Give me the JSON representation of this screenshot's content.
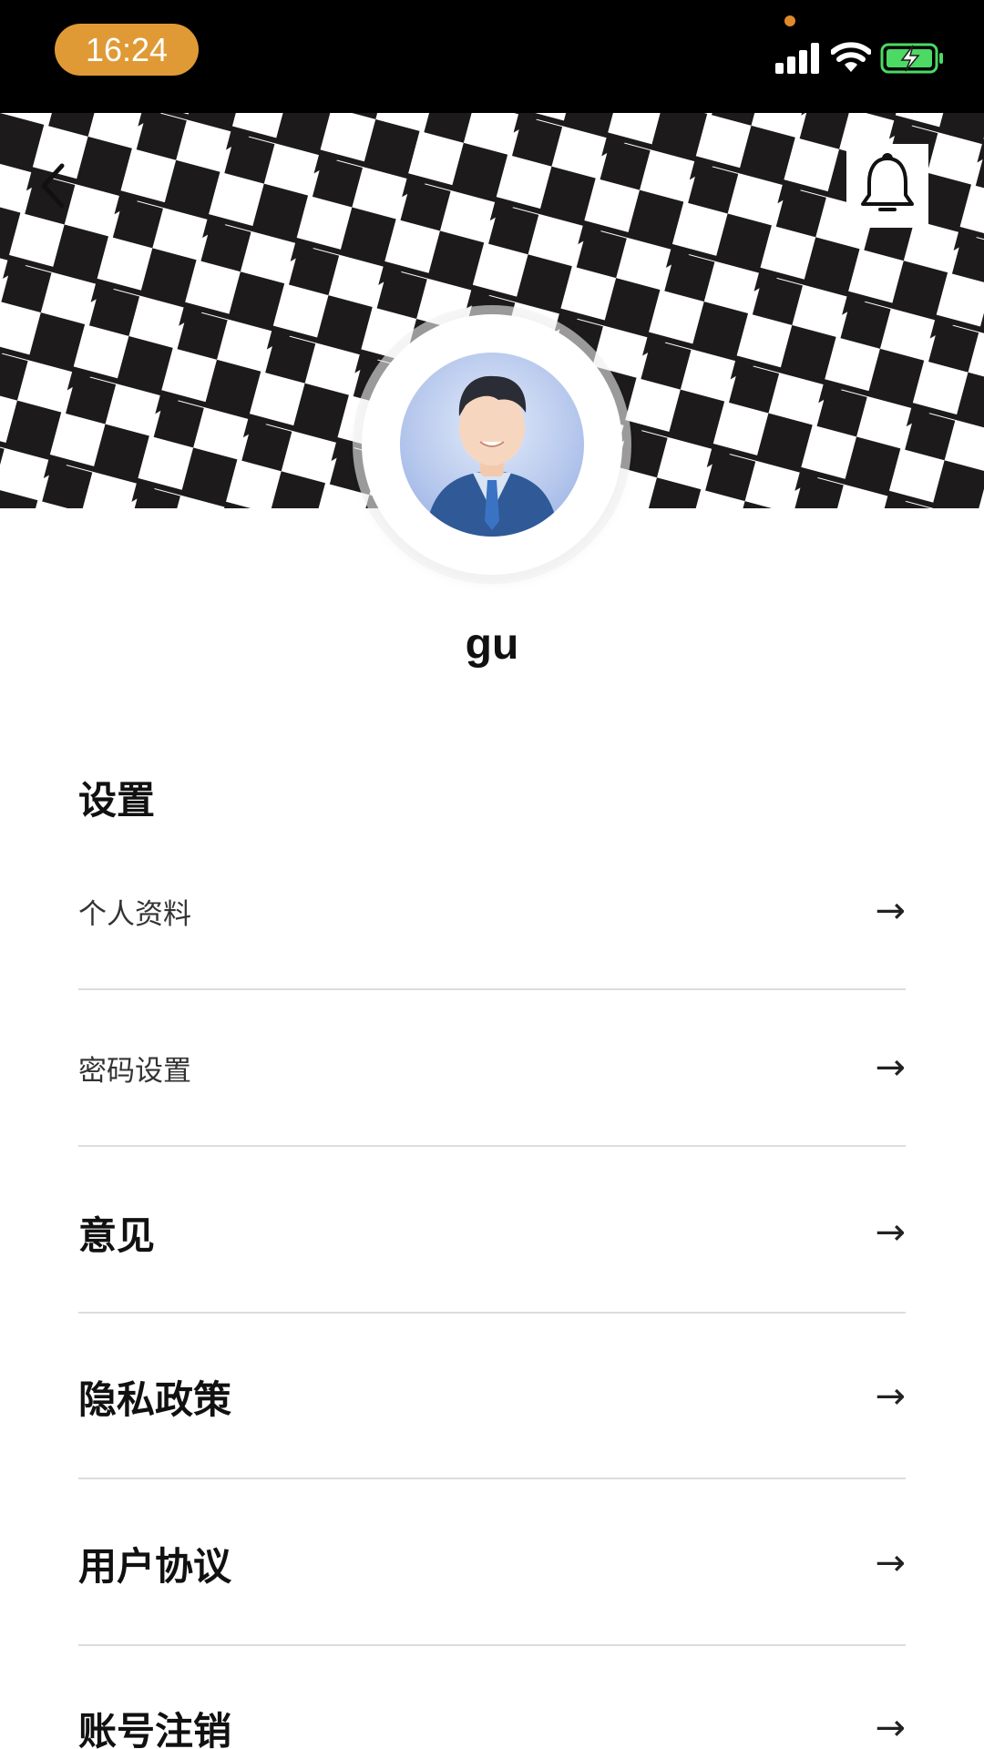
{
  "status_bar": {
    "time": "16:24",
    "time_pill_color": "#E09A35",
    "camera_indicator_color": "#E08A2A",
    "battery_color": "#4CD964",
    "icons": [
      "signal-icon",
      "wifi-icon",
      "battery-charging-icon"
    ]
  },
  "header": {
    "back_icon": "chevron-left-icon",
    "notification_icon": "bell-icon"
  },
  "profile": {
    "username": "gu",
    "avatar": "businessman-avatar"
  },
  "settings": {
    "title": "设置",
    "arrow": "→",
    "items": [
      {
        "label": "个人资料"
      },
      {
        "label": "密码设置"
      }
    ]
  },
  "menu": {
    "items": [
      {
        "label": "意见"
      },
      {
        "label": "隐私政策"
      },
      {
        "label": "用户协议"
      },
      {
        "label": "账号注销"
      }
    ]
  }
}
